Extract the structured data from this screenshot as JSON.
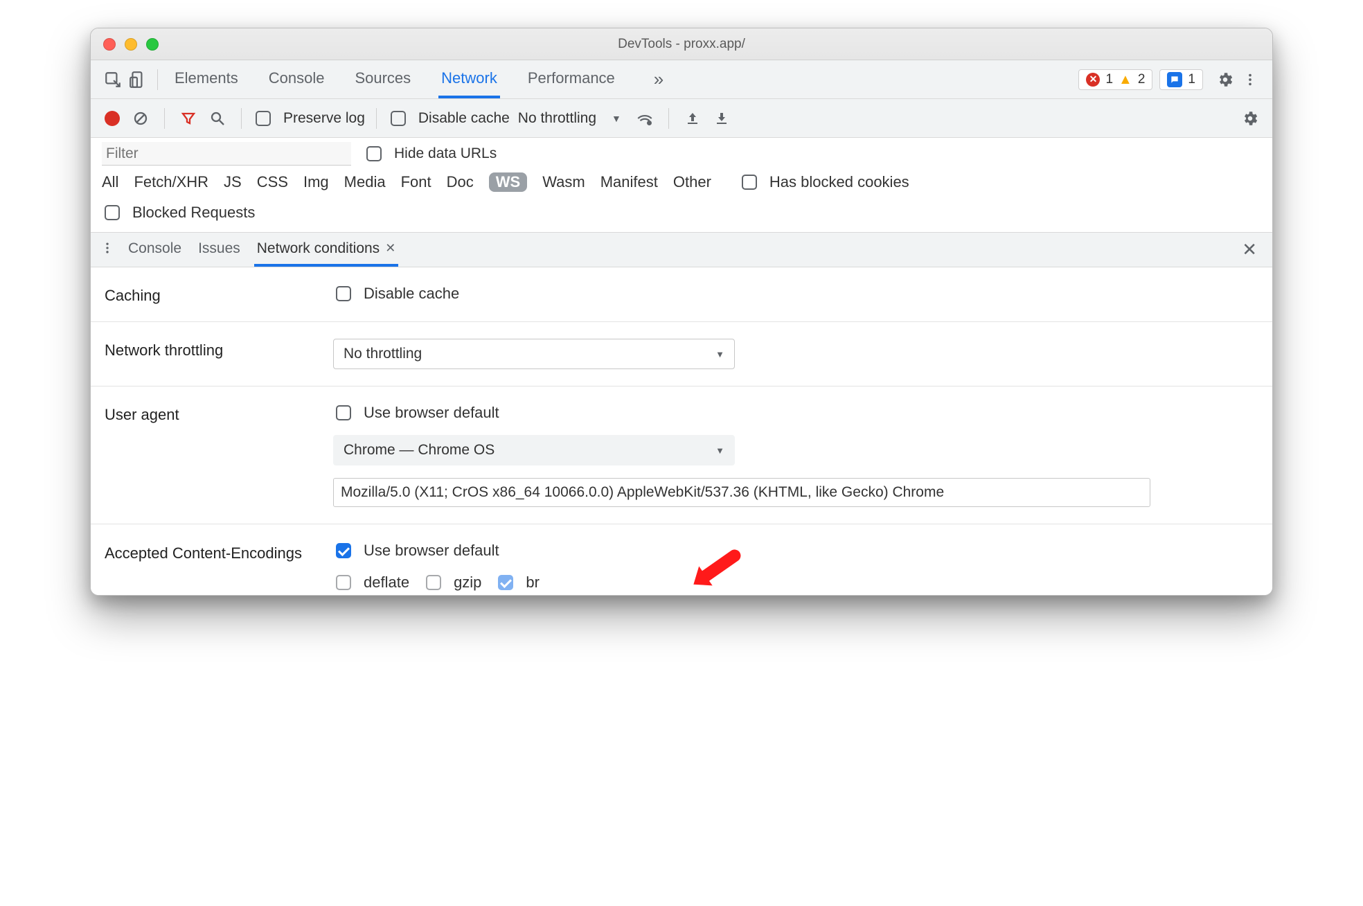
{
  "window": {
    "title": "DevTools - proxx.app/"
  },
  "tabs": {
    "items": [
      "Elements",
      "Console",
      "Sources",
      "Network",
      "Performance"
    ],
    "active": "Network"
  },
  "errors": {
    "errCount": "1",
    "warnCount": "2",
    "msgCount": "1"
  },
  "net_toolbar": {
    "preserve_log": "Preserve log",
    "disable_cache": "Disable cache",
    "throttling": "No throttling"
  },
  "filters": {
    "placeholder": "Filter",
    "hide_data_urls": "Hide data URLs",
    "chips": [
      "All",
      "Fetch/XHR",
      "JS",
      "CSS",
      "Img",
      "Media",
      "Font",
      "Doc",
      "WS",
      "Wasm",
      "Manifest",
      "Other"
    ],
    "has_blocked_cookies": "Has blocked cookies",
    "blocked_requests": "Blocked Requests"
  },
  "drawer": {
    "tabs": [
      "Console",
      "Issues",
      "Network conditions"
    ],
    "active": "Network conditions"
  },
  "conditions": {
    "caching_label": "Caching",
    "caching_disable_cache": "Disable cache",
    "throttling_label": "Network throttling",
    "throttling_value": "No throttling",
    "ua_label": "User agent",
    "ua_use_default": "Use browser default",
    "ua_select": "Chrome — Chrome OS",
    "ua_string": "Mozilla/5.0 (X11; CrOS x86_64 10066.0.0) AppleWebKit/537.36 (KHTML, like Gecko) Chrome",
    "encodings_label": "Accepted Content-Encodings",
    "encodings_use_default": "Use browser default",
    "enc_deflate": "deflate",
    "enc_gzip": "gzip",
    "enc_br": "br"
  }
}
